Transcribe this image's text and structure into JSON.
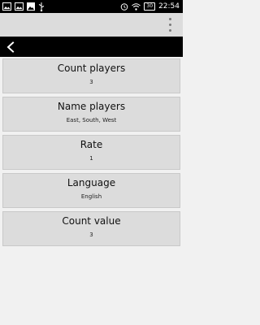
{
  "status_bar": {
    "time": "22:54",
    "battery_badge": "30",
    "icons_left": [
      "image-icon",
      "image-icon",
      "photo-icon",
      "usb-icon"
    ],
    "icons_right": [
      "alarm-icon",
      "wifi-icon",
      "battery-icon"
    ]
  },
  "header": {
    "menu_icon": "overflow-menu-icon"
  },
  "action_bar": {
    "back_icon": "chevron-left-icon"
  },
  "settings": [
    {
      "title": "Count players",
      "value": "3"
    },
    {
      "title": "Name players",
      "value": "East, South, West"
    },
    {
      "title": "Rate",
      "value": "1"
    },
    {
      "title": "Language",
      "value": "English"
    },
    {
      "title": "Count value",
      "value": "3"
    }
  ],
  "colors": {
    "status_bar": "#000000",
    "header": "#dcdcdc",
    "action_bar": "#000000",
    "item_bg": "#dcdcdc",
    "page_bg": "#f1f1f1"
  }
}
